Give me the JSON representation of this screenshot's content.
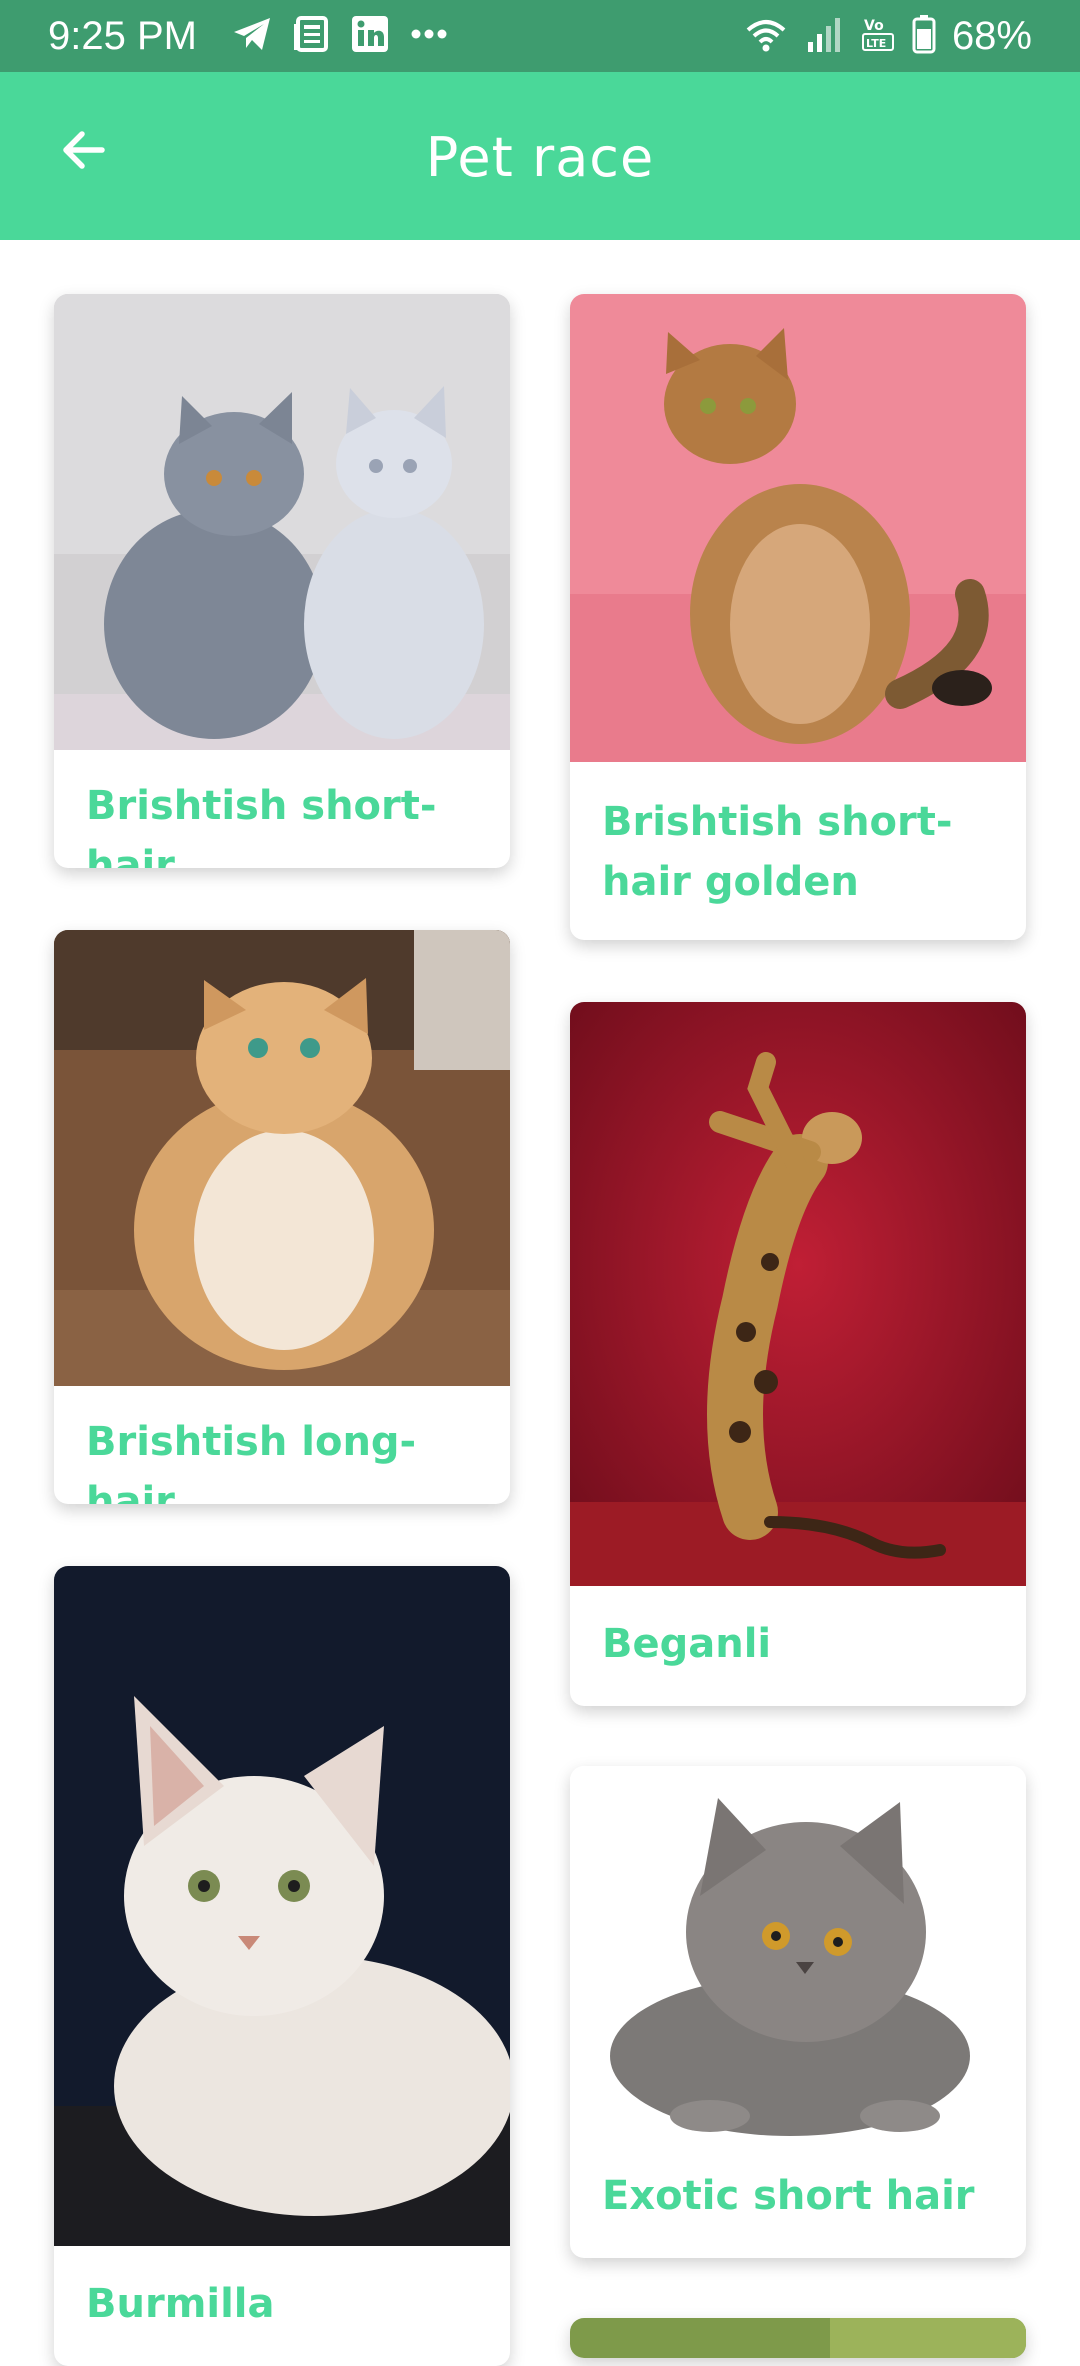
{
  "status_bar": {
    "time": "9:25 PM",
    "left_icons": [
      "telegram-icon",
      "news-icon",
      "linkedin-icon",
      "more-dots-icon"
    ],
    "right_icons": [
      "wifi-icon",
      "signal-icon",
      "volte-icon",
      "battery-icon"
    ],
    "battery_percent": "68%"
  },
  "app_bar": {
    "title": "Pet race",
    "back_icon": "arrow-left-icon"
  },
  "colors": {
    "status_bar": "#3e9c6f",
    "app_bar": "#4ad899",
    "accent_text": "#4ad899",
    "background": "#ffffff"
  },
  "breeds": [
    {
      "name": "Brishtish short-hair"
    },
    {
      "name": "Brishtish short-hair golden"
    },
    {
      "name": "Brishtish long-hair"
    },
    {
      "name": "Beganli"
    },
    {
      "name": "Burmilla"
    },
    {
      "name": "Exotic short hair"
    }
  ]
}
